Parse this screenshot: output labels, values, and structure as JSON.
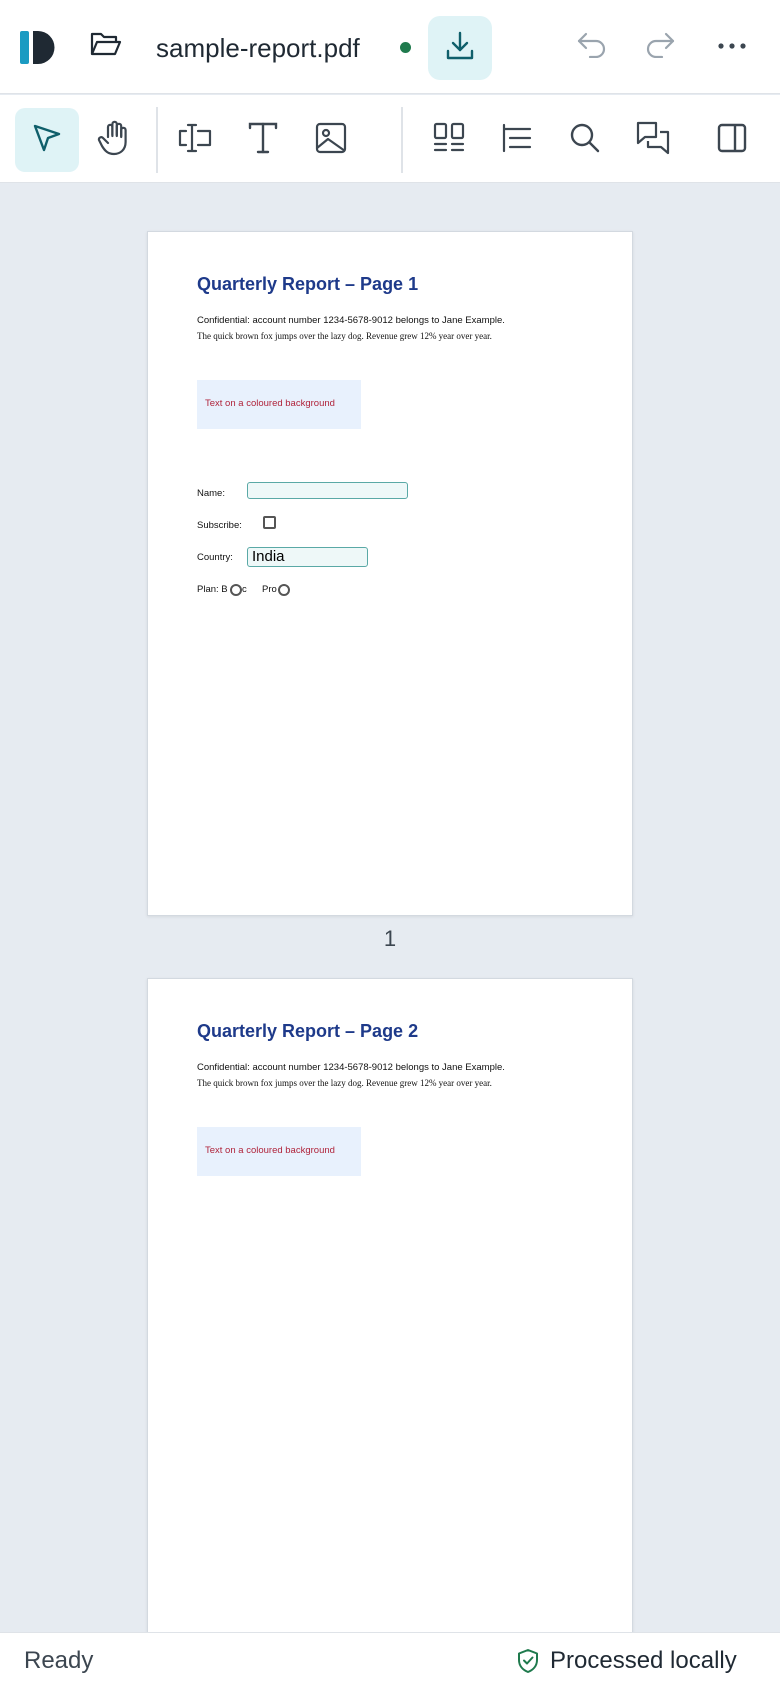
{
  "header": {
    "filename": "sample-report.pdf",
    "icons": [
      "app-logo",
      "folder-open-icon",
      "download-icon",
      "undo-icon",
      "redo-icon",
      "more-icon"
    ]
  },
  "toolbar": {
    "tools": [
      "select-tool",
      "pan-tool",
      "text-field-tool",
      "text-tool",
      "image-tool",
      "thumbnails-tool",
      "outline-tool",
      "search-tool",
      "comments-tool",
      "sidebar-toggle"
    ],
    "active_tool": "select-tool",
    "accent_color": "#dff3f6"
  },
  "pages": [
    {
      "title": "Quarterly Report – Page 1",
      "line1": "Confidential: account number 1234-5678-9012 belongs to Jane Example.",
      "line2": "The quick brown fox jumps over the lazy dog. Revenue grew 12% year over year.",
      "box_text": "Text on a coloured background",
      "form": {
        "name_label": "Name:",
        "subscribe_label": "Subscribe:",
        "country_label": "Country:",
        "country_value": "India",
        "plan_label": "Plan: B",
        "plan_basic_suffix": "c",
        "plan_pro_label": "Pro"
      },
      "page_number": "1"
    },
    {
      "title": "Quarterly Report – Page 2",
      "line1": "Confidential: account number 1234-5678-9012 belongs to Jane Example.",
      "line2": "The quick brown fox jumps over the lazy dog. Revenue grew 12% year over year.",
      "box_text": "Text on a coloured background"
    }
  ],
  "status": {
    "left": "Ready",
    "right": "Processed locally"
  }
}
